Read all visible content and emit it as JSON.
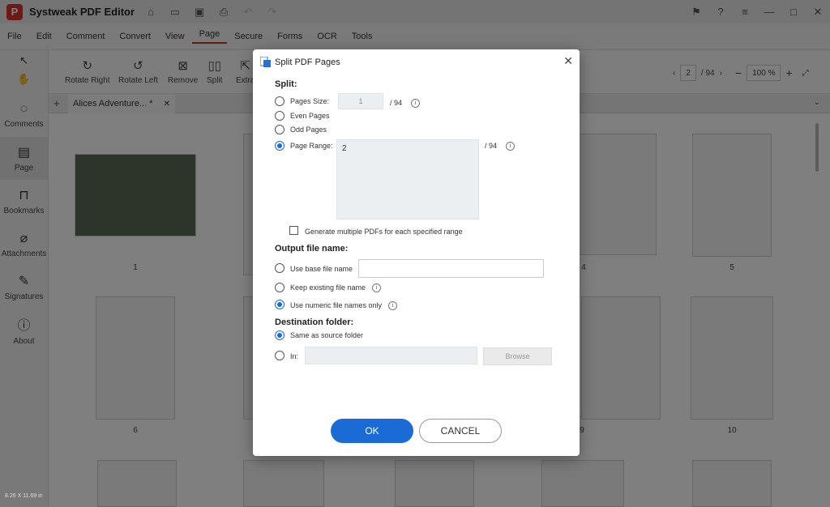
{
  "app": {
    "title": "Systweak PDF Editor"
  },
  "menu": [
    "File",
    "Edit",
    "Comment",
    "Convert",
    "View",
    "Page",
    "Secure",
    "Forms",
    "OCR",
    "Tools"
  ],
  "sidebar": [
    {
      "label": "Comments",
      "icon": "comment-icon"
    },
    {
      "label": "Page",
      "icon": "page-icon"
    },
    {
      "label": "Bookmarks",
      "icon": "bookmark-icon"
    },
    {
      "label": "Attachments",
      "icon": "paperclip-icon"
    },
    {
      "label": "Signatures",
      "icon": "signature-icon"
    },
    {
      "label": "About",
      "icon": "info-icon"
    }
  ],
  "toolbar": {
    "tools": [
      "Rotate Right",
      "Rotate Left",
      "Remove",
      "Split",
      "Extra"
    ],
    "page_current": "2",
    "page_total": "/ 94",
    "zoom": "100 %"
  },
  "tab": {
    "title": "Alices Adventure... *"
  },
  "pages": {
    "row1": [
      "1",
      "4",
      "5"
    ],
    "row2": [
      "6",
      "9",
      "10"
    ]
  },
  "status": "8.26 X 11.69 in",
  "dialog": {
    "title": "Split PDF Pages",
    "split_heading": "Split:",
    "pages_size_label": "Pages Size:",
    "pages_size_value": "1",
    "pages_size_total": "/ 94",
    "even_label": "Even Pages",
    "odd_label": "Odd Pages",
    "range_label": "Page Range:",
    "range_value": "2",
    "range_total": "/ 94",
    "multi_label": "Generate multiple PDFs for each specified range",
    "output_heading": "Output file name:",
    "base_label": "Use base file name",
    "keep_label": "Keep existing file name",
    "numeric_label": "Use numeric file names only",
    "dest_heading": "Destination folder:",
    "same_label": "Same as source folder",
    "in_label": "In:",
    "browse_label": "Browse",
    "ok_label": "OK",
    "cancel_label": "CANCEL"
  }
}
